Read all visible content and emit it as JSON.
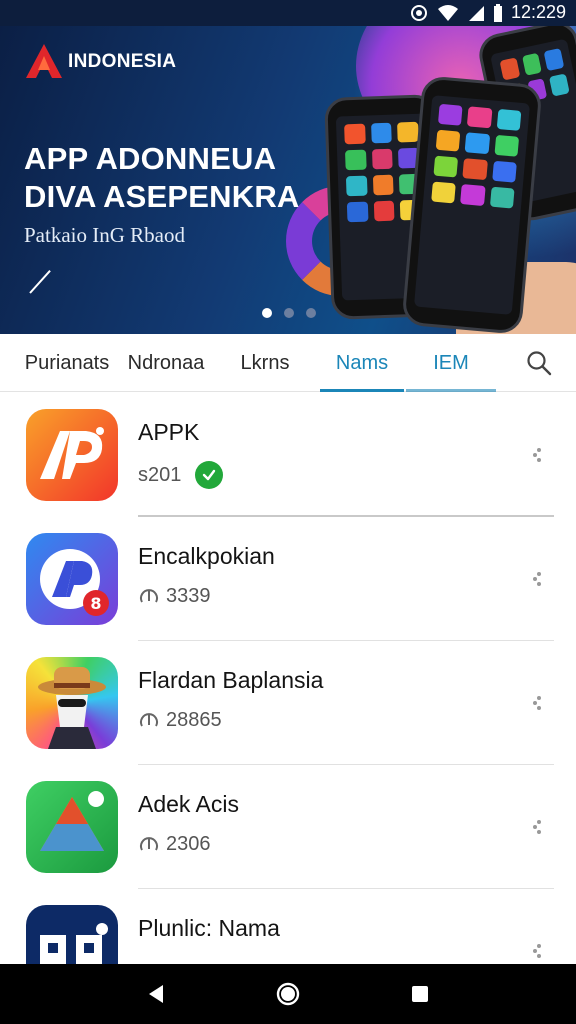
{
  "status_bar": {
    "time": "12:229"
  },
  "banner": {
    "logo_text": "INDONESIA",
    "title_line1": "APP ADONNEUA",
    "title_line2": "DIVA ASEPENKRA",
    "subtitle": "Patkaio InG Rbaod",
    "carousel_total": 3,
    "carousel_active": 1
  },
  "tabs": [
    {
      "label": "Purianats"
    },
    {
      "label": "Ndronaa"
    },
    {
      "label": "Lkrns"
    },
    {
      "label": "Nams",
      "active": true
    },
    {
      "label": "IEM"
    }
  ],
  "apps": [
    {
      "name": "APPK",
      "meta": "s201",
      "verified": true,
      "icon": "ap-logo-icon",
      "colors": [
        "#f6501f",
        "#f9a12a"
      ]
    },
    {
      "name": "Encalkpokian",
      "meta": "3339",
      "icon": "ap-circle-logo-icon",
      "colors": [
        "#3a6ff0",
        "#7a3dd8"
      ]
    },
    {
      "name": "Flardan Baplansia",
      "meta": "28865",
      "icon": "hat-character-icon",
      "colors": [
        "#ff4f8a",
        "#35c7f0"
      ]
    },
    {
      "name": "Adek Acis",
      "meta": "2306",
      "icon": "triangle-logo-icon",
      "colors": [
        "#1fa34a",
        "#35c35a"
      ]
    },
    {
      "name": "Plunlic: Nama",
      "meta": "",
      "icon": "pp-logo-icon",
      "colors": [
        "#0d2a66",
        "#0d2a66"
      ]
    }
  ],
  "icons": {
    "status": [
      "camera-icon",
      "wifi-icon",
      "signal-icon",
      "battery-icon"
    ],
    "nav": [
      "back-icon",
      "home-icon",
      "recents-icon"
    ]
  },
  "colors": {
    "accent": "#1b86b8",
    "hero_bg": "#0b1f45",
    "verified": "#22a83a"
  }
}
